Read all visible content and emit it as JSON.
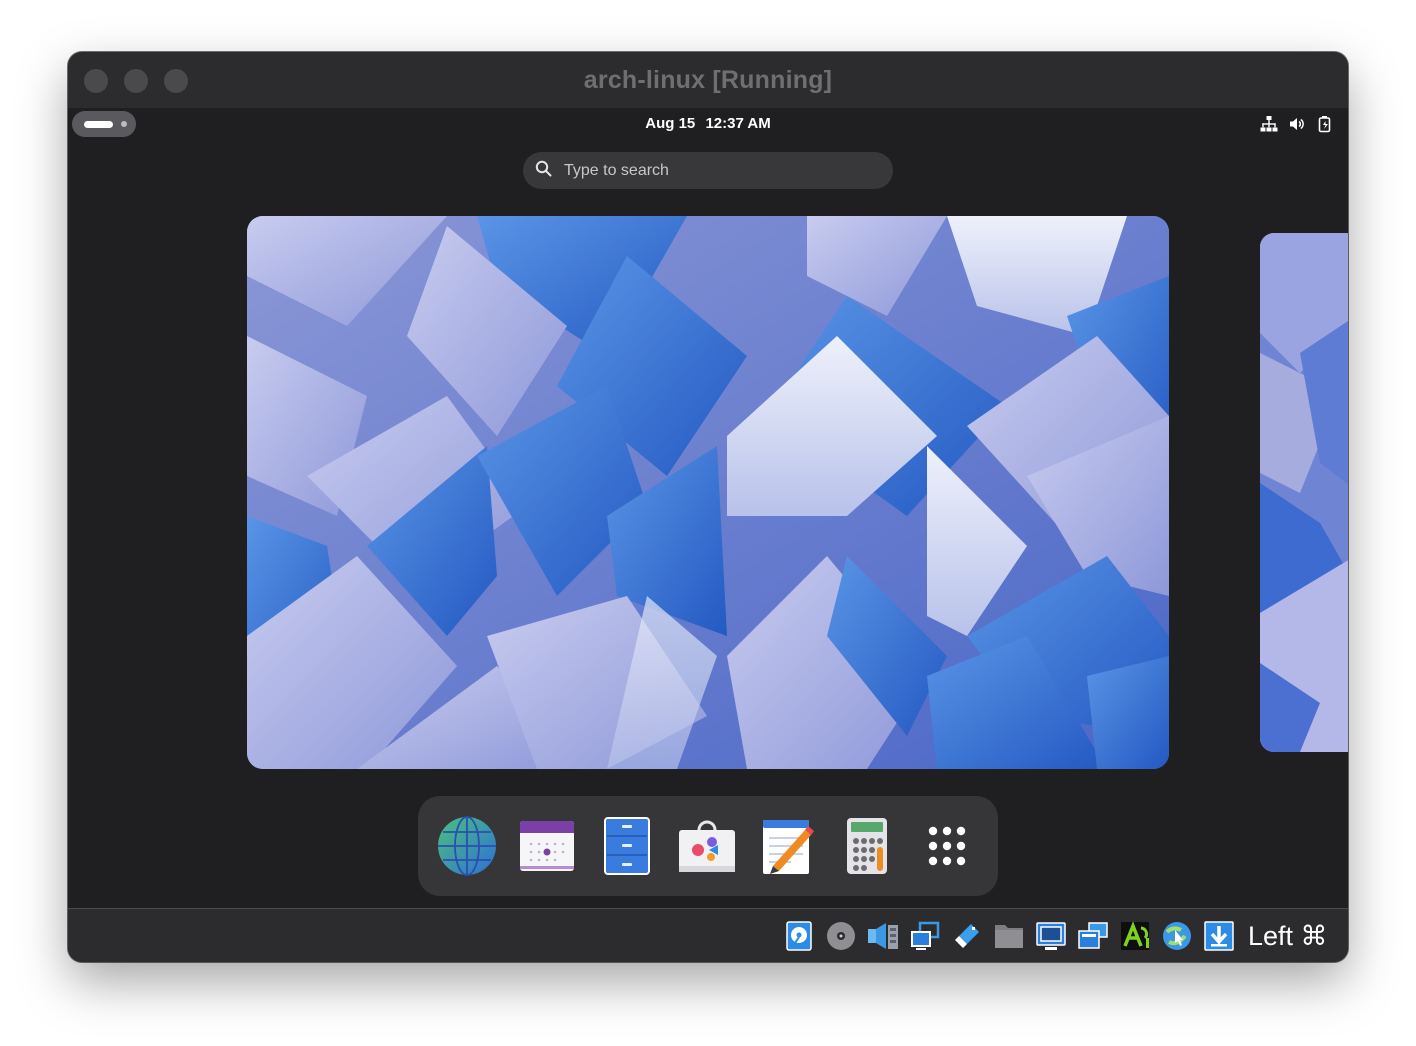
{
  "window": {
    "title": "arch-linux [Running]"
  },
  "topbar": {
    "date": "Aug 15",
    "time": "12:37 AM",
    "tray": [
      "network-icon",
      "volume-icon",
      "battery-icon"
    ]
  },
  "search": {
    "placeholder": "Type to search",
    "value": ""
  },
  "dash": {
    "apps": [
      {
        "name": "web-browser-icon"
      },
      {
        "name": "calendar-icon"
      },
      {
        "name": "file-cabinet-icon"
      },
      {
        "name": "software-store-icon"
      },
      {
        "name": "text-editor-icon"
      },
      {
        "name": "calculator-icon"
      },
      {
        "name": "show-apps-icon"
      }
    ]
  },
  "statusbar": {
    "icons": [
      "hard-disk-icon",
      "optical-drive-icon",
      "audio-icon",
      "network-adapters-icon",
      "usb-icon",
      "shared-folders-icon",
      "display-icon",
      "recording-icon",
      "cpu-icon",
      "mouse-integration-icon",
      "download-icon"
    ],
    "host_key": "Left ⌘"
  },
  "colors": {
    "accent": "#3a7be0",
    "window_bg": "#1f1f21",
    "titlebar": "#2c2c2e"
  }
}
